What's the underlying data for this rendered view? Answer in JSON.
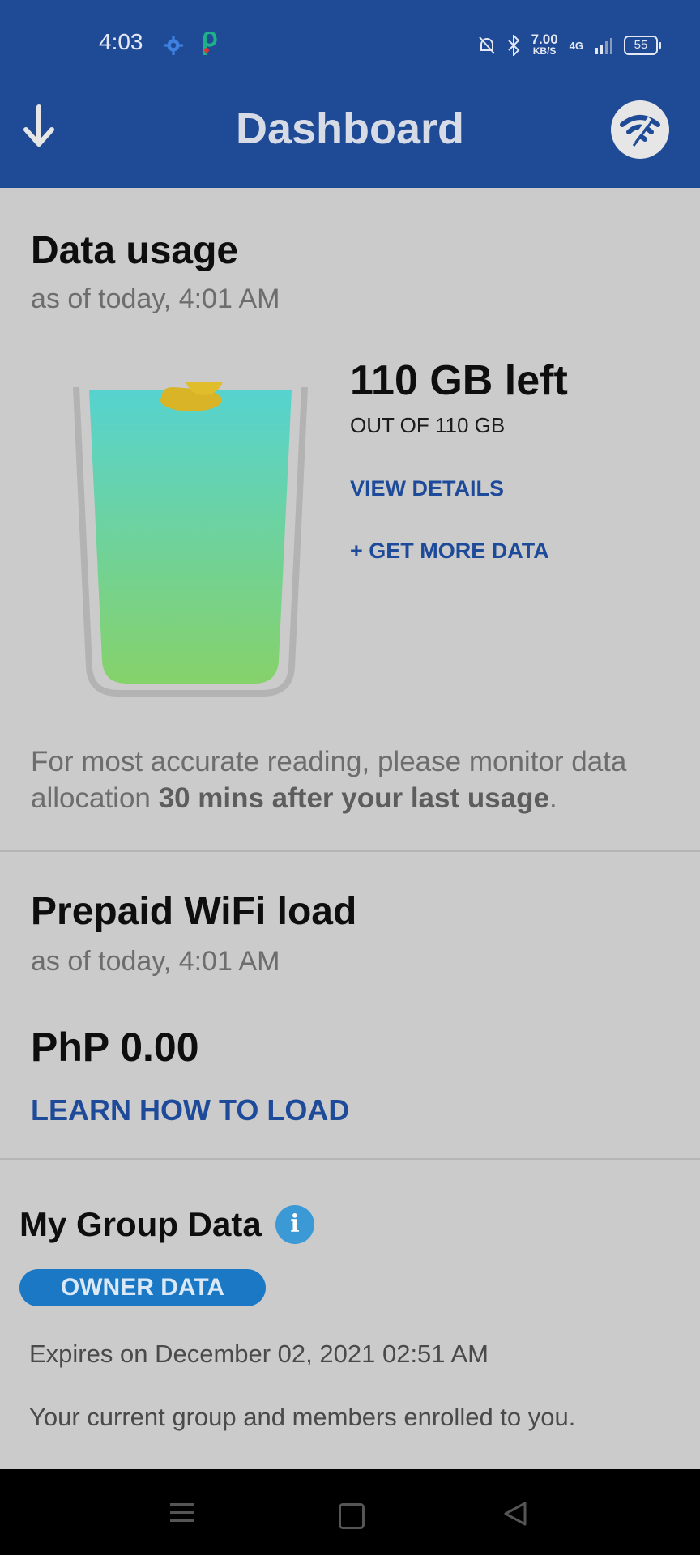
{
  "status_bar": {
    "time": "4:03",
    "speed": "7.00",
    "speed_unit": "KB/S",
    "network": "4G",
    "battery": "55"
  },
  "header": {
    "title": "Dashboard",
    "back_icon": "arrow-down-icon",
    "wifi_icon": "wifi-broken-icon"
  },
  "data_usage": {
    "title": "Data usage",
    "as_of": "as of today, 4:01 AM",
    "remaining": "110 GB left",
    "out_of": "OUT OF 110 GB",
    "view_details": "VIEW DETAILS",
    "get_more": "+ GET MORE DATA",
    "note_prefix": "For most accurate reading, please monitor data allocation ",
    "note_bold": "30 mins after your last usage",
    "note_suffix": ".",
    "fill_fraction": 1.0
  },
  "prepaid": {
    "title": "Prepaid WiFi load",
    "as_of": "as of today, 4:01 AM",
    "balance": "PhP 0.00",
    "learn_link": "LEARN HOW TO LOAD"
  },
  "group": {
    "title": "My Group Data",
    "badge": "OWNER DATA",
    "expires": "Expires on December 02, 2021 02:51 AM",
    "description": "Your current group and members enrolled to you."
  },
  "colors": {
    "header_bg": "#1f4a96",
    "link": "#1e4a9a",
    "badge_bg": "#1b78c4",
    "water_top": "#56d3cf",
    "water_bottom": "#86d26a"
  }
}
